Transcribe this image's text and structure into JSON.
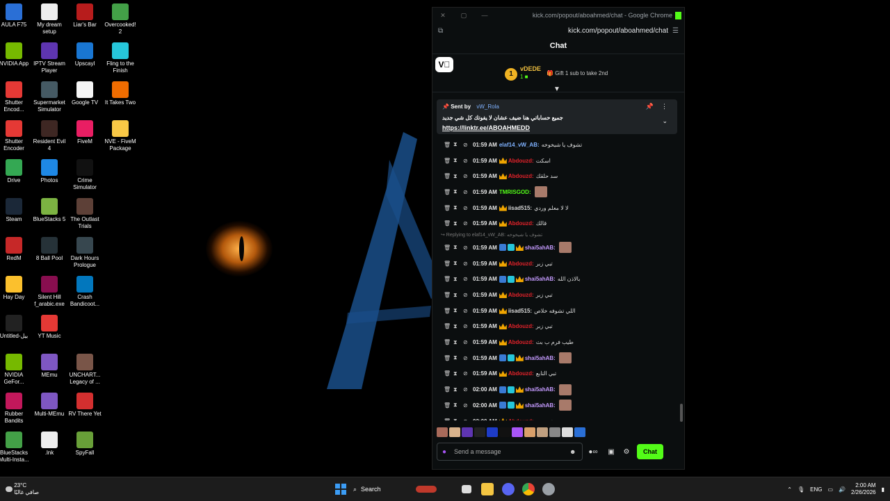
{
  "desktop": {
    "columns": [
      [
        {
          "label": "AULA F75",
          "color": "#2a6fd6"
        },
        {
          "label": "NVIDIA App",
          "color": "#76b900"
        },
        {
          "label": "Shutter Encod...",
          "color": "#e53935"
        },
        {
          "label": "Shutter Encoder",
          "color": "#e53935"
        },
        {
          "label": "Drive",
          "color": "#34a853"
        },
        {
          "label": "Steam",
          "color": "#1b2838"
        },
        {
          "label": "RedM",
          "color": "#c62828"
        },
        {
          "label": "Hay Day",
          "color": "#fbc02d"
        },
        {
          "label": "Untitled-بيل",
          "color": "#222222"
        },
        {
          "label": "NVIDIA GeFor...",
          "color": "#76b900"
        },
        {
          "label": "Rubber Bandits",
          "color": "#c2185b"
        },
        {
          "label": "BlueStacks Multi-Insta...",
          "color": "#43a047"
        }
      ],
      [
        {
          "label": "My dream setup",
          "color": "#eeeeee"
        },
        {
          "label": "IPTV Stream Player",
          "color": "#5e35b1"
        },
        {
          "label": "Supermarket Simulator",
          "color": "#455a64"
        },
        {
          "label": "Resident Evil 4",
          "color": "#3e2723"
        },
        {
          "label": "Photos",
          "color": "#1e88e5"
        },
        {
          "label": "BlueStacks 5",
          "color": "#7cb342"
        },
        {
          "label": "8 Ball Pool",
          "color": "#263238"
        },
        {
          "label": "Silent Hill f_arabic.exe",
          "color": "#880e4f"
        },
        {
          "label": "YT Music",
          "color": "#e53935"
        },
        {
          "label": "MEmu",
          "color": "#7e57c2"
        },
        {
          "label": "Multi-MEmu",
          "color": "#7e57c2"
        },
        {
          "label": ".lnk",
          "color": "#eeeeee"
        }
      ],
      [
        {
          "label": "Liar's Bar",
          "color": "#b71c1c"
        },
        {
          "label": "Upscayl",
          "color": "#1976d2"
        },
        {
          "label": "Google TV",
          "color": "#f5f5f5"
        },
        {
          "label": "FiveM",
          "color": "#e91e63"
        },
        {
          "label": "Crime Simulator",
          "color": "#111111"
        },
        {
          "label": "The Outlast Trials",
          "color": "#5d4037"
        },
        {
          "label": "Dark Hours Prologue",
          "color": "#37474f"
        },
        {
          "label": "Crash Bandicoot...",
          "color": "#0277bd"
        },
        {
          "label": "",
          "color": ""
        },
        {
          "label": "UNCHART... Legacy of ...",
          "color": "#795548"
        },
        {
          "label": "RV There Yet",
          "color": "#d32f2f"
        },
        {
          "label": "SpyFall",
          "color": "#689f38"
        }
      ],
      [
        {
          "label": "Overcooked! 2",
          "color": "#43a047"
        },
        {
          "label": "Fling to the Finish",
          "color": "#26c6da"
        },
        {
          "label": "It Takes Two",
          "color": "#ef6c00"
        },
        {
          "label": "NVE - FiveM Package",
          "color": "#f9c846"
        }
      ]
    ]
  },
  "window": {
    "title": "kick.com/popout/aboahmed/chat - Google Chrome",
    "url": "kick.com/popout/aboahmed/chat"
  },
  "chat": {
    "header": "Chat",
    "logo": "✔̅",
    "gifter": {
      "rank": "1",
      "name": "vDEDE",
      "count": "1 ■",
      "gift_text": "Gift 1 sub to take 2nd"
    },
    "pinned": {
      "sent_by_label": "Sent by",
      "user": "vW_Rola",
      "message": "جميع حساباتي هنا ضيف عشان لا يفوتك كل شي جديد",
      "link": "https://linktr.ee/ABOAHMEDD"
    },
    "colors": {
      "accent": "#53fc18",
      "red_user": "#e3222a",
      "green_user": "#53fc18",
      "purple_user": "#c59bff",
      "blue_user": "#7fb2ff"
    },
    "messages": [
      {
        "time": "01:59 AM",
        "user": "elaf14_vW_AB:",
        "text": "تشوف يا شيخوخه",
        "color": "#7fb2ff",
        "crown": false,
        "badges": [],
        "emote": false
      },
      {
        "time": "01:59 AM",
        "user": "Abdouzd:",
        "text": "اسكت",
        "color": "#e3222a",
        "crown": true,
        "badges": [],
        "emote": false
      },
      {
        "time": "01:59 AM",
        "user": "Abdouzd:",
        "text": "سد حلقك",
        "color": "#e3222a",
        "crown": true,
        "badges": [],
        "emote": false
      },
      {
        "time": "01:59 AM",
        "user": "TMRISGOD:",
        "text": "",
        "color": "#53fc18",
        "crown": false,
        "badges": [],
        "emote": true
      },
      {
        "time": "01:59 AM",
        "user": "iisad515:",
        "text": "لا لا معلم وردي",
        "color": "#d9d9d9",
        "crown": true,
        "badges": [],
        "emote": false
      },
      {
        "time": "01:59 AM",
        "user": "Abdouzd:",
        "text": "قالك",
        "color": "#e3222a",
        "crown": true,
        "badges": [],
        "emote": false
      },
      {
        "reply": "Replying to elaf14_vW_AB: تشوف يا شيخوخه"
      },
      {
        "time": "01:59 AM",
        "user": "shai5ahAB:",
        "text": "",
        "color": "#c59bff",
        "crown": true,
        "badges": [
          "#3a7bd5",
          "#26c6da"
        ],
        "emote": true
      },
      {
        "time": "01:59 AM",
        "user": "Abdouzd:",
        "text": "تبي زبر",
        "color": "#e3222a",
        "crown": true,
        "badges": [],
        "emote": false
      },
      {
        "time": "01:59 AM",
        "user": "shai5ahAB:",
        "text": "بالاذن الله",
        "color": "#c59bff",
        "crown": true,
        "badges": [
          "#3a7bd5",
          "#26c6da"
        ],
        "emote": false
      },
      {
        "time": "01:59 AM",
        "user": "Abdouzd:",
        "text": "تبي زبر",
        "color": "#e3222a",
        "crown": true,
        "badges": [],
        "emote": false
      },
      {
        "time": "01:59 AM",
        "user": "iisad515:",
        "text": "اللي تشوفه خلاص",
        "color": "#d9d9d9",
        "crown": true,
        "badges": [],
        "emote": false
      },
      {
        "time": "01:59 AM",
        "user": "Abdouzd:",
        "text": "تبي زبر",
        "color": "#e3222a",
        "crown": true,
        "badges": [],
        "emote": false
      },
      {
        "time": "01:59 AM",
        "user": "Abdouzd:",
        "text": "طيب فرم ب بث",
        "color": "#e3222a",
        "crown": true,
        "badges": [],
        "emote": false
      },
      {
        "time": "01:59 AM",
        "user": "shai5ahAB:",
        "text": "",
        "color": "#c59bff",
        "crown": true,
        "badges": [
          "#3a7bd5",
          "#26c6da"
        ],
        "emote": true
      },
      {
        "time": "01:59 AM",
        "user": "Abdouzd:",
        "text": "تبي التابع",
        "color": "#e3222a",
        "crown": true,
        "badges": [],
        "emote": false
      },
      {
        "time": "02:00 AM",
        "user": "shai5ahAB:",
        "text": "",
        "color": "#c59bff",
        "crown": true,
        "badges": [
          "#3a7bd5",
          "#26c6da"
        ],
        "emote": true
      },
      {
        "time": "02:00 AM",
        "user": "shai5ahAB:",
        "text": "",
        "color": "#c59bff",
        "crown": true,
        "badges": [
          "#3a7bd5",
          "#26c6da"
        ],
        "emote": true
      },
      {
        "time": "02:00 AM",
        "user": "Abdouzd:",
        "text": "تبي زبر",
        "color": "#e3222a",
        "crown": true,
        "badges": [],
        "emote": false
      }
    ],
    "emote_colors": [
      "#a86a5a",
      "#d9b38c",
      "#5e35b1",
      "#222",
      "#1e3cc8",
      "#111",
      "#a855f7",
      "#d9a06a",
      "#c0a080",
      "#888",
      "#ddd",
      "#2a6fd6"
    ],
    "input_placeholder": "Send a message",
    "send_label": "Chat"
  },
  "taskbar": {
    "temp": "23°C",
    "weather_text": "صافي غالبًا",
    "search_label": "Search",
    "lang": "ENG",
    "time": "2:00 AM",
    "date": "2/26/2026"
  }
}
